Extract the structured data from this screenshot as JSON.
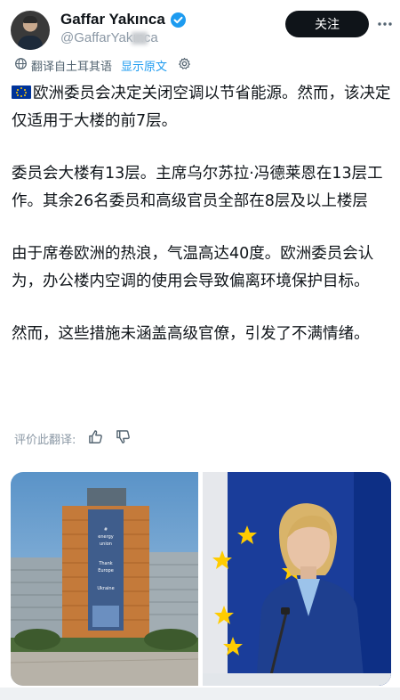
{
  "author": {
    "display_name": "Gaffar Yakınca",
    "handle": "@GaffarYakınca",
    "avatar_icon": "avatar"
  },
  "actions": {
    "follow_label": "关注",
    "more_icon": "more-icon"
  },
  "translation": {
    "notice": "翻译自土耳其语",
    "show_original": "显示原文",
    "settings_icon": "gear-icon"
  },
  "post": {
    "paragraphs": [
      "欧洲委员会决定关闭空调以节省能源。然而，该决定仅适用于大楼的前7层。",
      "委员会大楼有13层。主席乌尔苏拉·冯德莱恩在13层工作。其余26名委员和高级官员全部在8层及以上楼层",
      "由于席卷欧洲的热浪，气温高达40度。欧洲委员会认为，办公楼内空调的使用会导致偏离环境保护目标。",
      "然而，这些措施未涵盖高级官僚，引发了不满情绪。"
    ]
  },
  "rating": {
    "label": "评价此翻译:"
  },
  "media": {
    "left_poster_lines": [
      "#",
      "energy",
      "union",
      "Thank",
      "Europe",
      "Ukraine"
    ],
    "colors": {
      "eu_blue": "#003399",
      "eu_gold": "#ffcc00",
      "accent": "#1d9bf0"
    }
  }
}
